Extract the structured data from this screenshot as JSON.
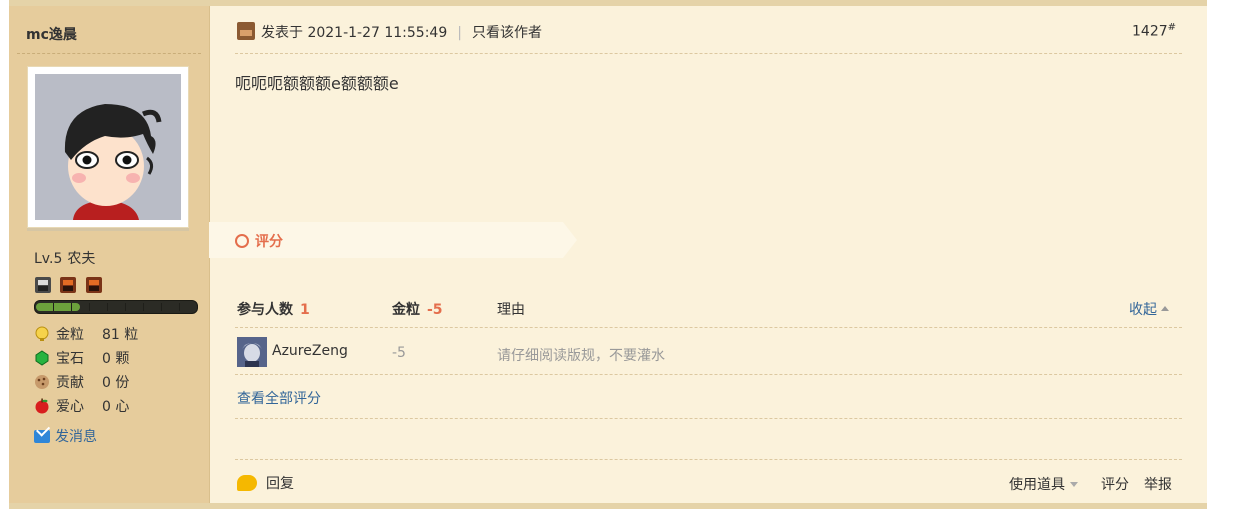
{
  "user": {
    "name": "mc逸晨",
    "level": "Lv.5",
    "rank": "农夫",
    "stats": [
      {
        "icon": "gold-nugget-icon",
        "label": "金粒",
        "value": "81 粒"
      },
      {
        "icon": "emerald-icon",
        "label": "宝石",
        "value": "0 颗"
      },
      {
        "icon": "cookie-icon",
        "label": "贡献",
        "value": "0 份"
      },
      {
        "icon": "apple-icon",
        "label": "爱心",
        "value": "0 心"
      }
    ],
    "send_message": "发消息"
  },
  "post": {
    "posted_label": "发表于 2021-1-27 11:55:49",
    "only_author": "只看该作者",
    "floor": "1427",
    "floor_mark": "#",
    "content": "呃呃呃额额额e额额额e"
  },
  "rating": {
    "tab_label": "评分",
    "participants_label": "参与人数",
    "participants_value": "1",
    "gold_label": "金粒",
    "gold_value": "-5",
    "reason_label": "理由",
    "collapse_label": "收起",
    "rows": [
      {
        "user": "AzureZeng",
        "score": "-5",
        "reason": "请仔细阅读版规，不要灌水"
      }
    ],
    "view_all": "查看全部评分"
  },
  "footer": {
    "reply": "回复",
    "use_tool": "使用道具",
    "rate": "评分",
    "report": "举报"
  }
}
